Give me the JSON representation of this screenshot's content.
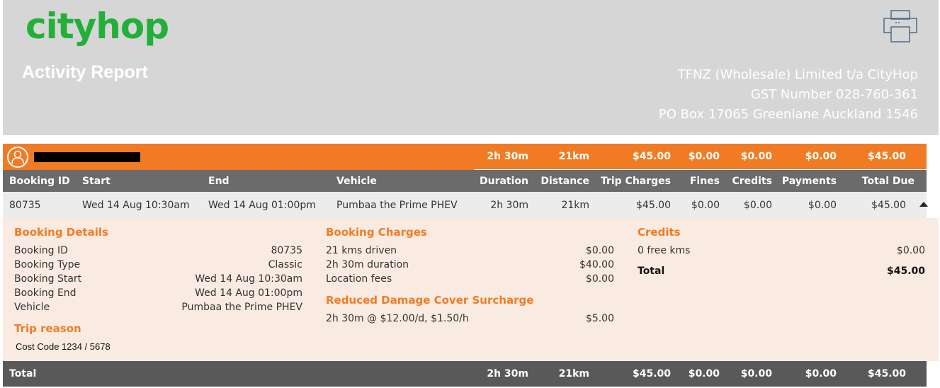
{
  "header": {
    "logo_text": "cityhop",
    "report_title": "Activity Report",
    "company_line1": "TFNZ (Wholesale) Limited t/a CityHop",
    "company_line2": "GST Number 028-760-361",
    "company_line3": "PO Box 17065 Greenlane Auckland 1546",
    "print_icon": "printer-icon"
  },
  "colors": {
    "brand_green": "#22b03a",
    "accent_orange": "#f17b24",
    "header_grey": "#d6d6d6",
    "column_header_grey": "#6b6b6b",
    "total_grey": "#595959",
    "detail_bg": "#f9ebe1"
  },
  "summary": {
    "user_icon": "user-icon",
    "duration": "2h 30m",
    "distance": "21km",
    "trip_charges": "$45.00",
    "fines": "$0.00",
    "credits": "$0.00",
    "payments": "$0.00",
    "total_due": "$45.00"
  },
  "columns": {
    "booking_id": "Booking ID",
    "start": "Start",
    "end": "End",
    "vehicle": "Vehicle",
    "duration": "Duration",
    "distance": "Distance",
    "trip_charges": "Trip Charges",
    "fines": "Fines",
    "credits": "Credits",
    "payments": "Payments",
    "total_due": "Total Due"
  },
  "booking": {
    "booking_id": "80735",
    "start": "Wed 14 Aug 10:30am",
    "end": "Wed 14 Aug 01:00pm",
    "vehicle": "Pumbaa the Prime PHEV",
    "duration": "2h 30m",
    "distance": "21km",
    "trip_charges": "$45.00",
    "fines": "$0.00",
    "credits": "$0.00",
    "payments": "$0.00",
    "total_due": "$45.00",
    "toggle_icon": "caret-up-icon"
  },
  "details": {
    "booking_details_title": "Booking Details",
    "booking_details": [
      {
        "label": "Booking ID",
        "value": "80735"
      },
      {
        "label": "Booking Type",
        "value": "Classic"
      },
      {
        "label": "Booking Start",
        "value": "Wed 14 Aug 10:30am"
      },
      {
        "label": "Booking End",
        "value": "Wed 14 Aug 01:00pm"
      },
      {
        "label": "Vehicle",
        "value": "Pumbaa the Prime PHEV"
      }
    ],
    "trip_reason_title": "Trip reason",
    "trip_reason": "Cost Code 1234 / 5678",
    "booking_charges_title": "Booking Charges",
    "booking_charges": [
      {
        "label": "21 kms driven",
        "value": "$0.00"
      },
      {
        "label": "2h 30m duration",
        "value": "$40.00"
      },
      {
        "label": "Location fees",
        "value": "$0.00"
      }
    ],
    "surcharge_title": "Reduced Damage Cover Surcharge",
    "surcharge": {
      "label": "2h 30m @ $12.00/d, $1.50/h",
      "value": "$5.00"
    },
    "credits_title": "Credits",
    "credits": [
      {
        "label": "0 free kms",
        "value": "$0.00"
      }
    ],
    "total_label": "Total",
    "total_value": "$45.00"
  },
  "totals": {
    "label": "Total",
    "duration": "2h 30m",
    "distance": "21km",
    "trip_charges": "$45.00",
    "fines": "$0.00",
    "credits": "$0.00",
    "payments": "$0.00",
    "total_due": "$45.00"
  }
}
